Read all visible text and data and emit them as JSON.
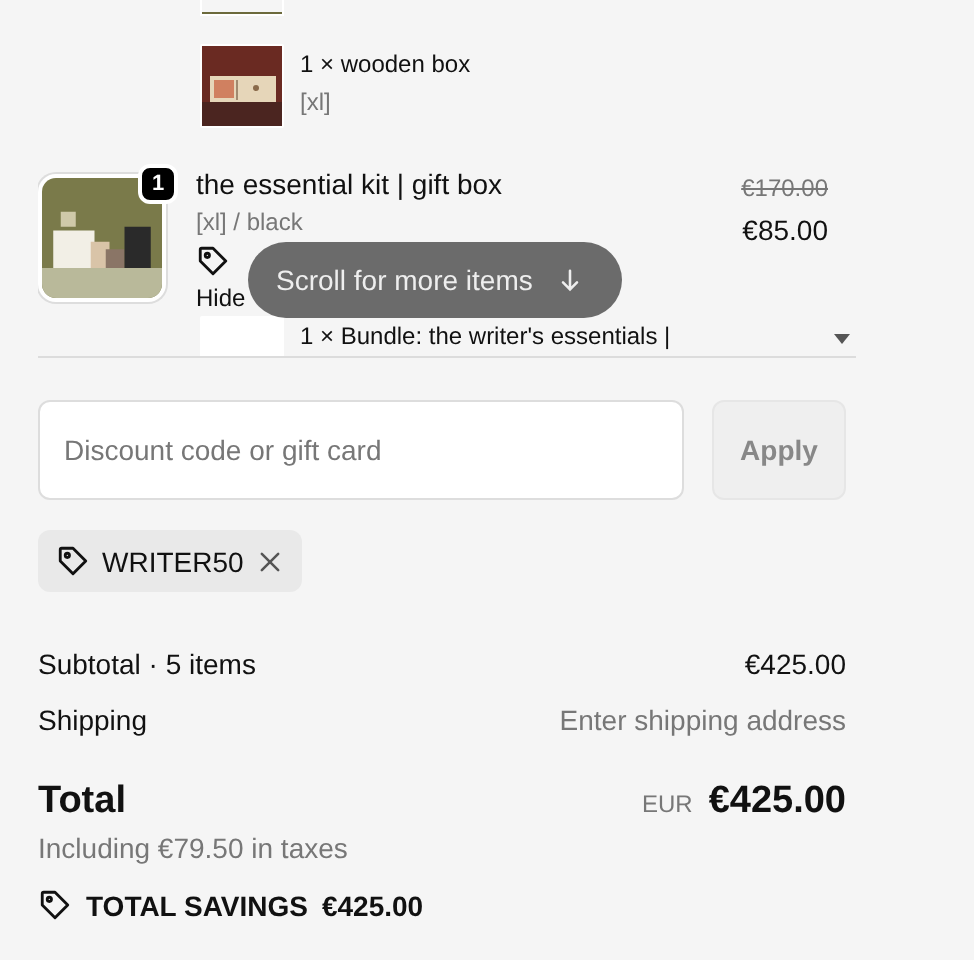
{
  "cart": {
    "items": [
      {
        "kind": "stub"
      },
      {
        "kind": "child",
        "title": "1 × wooden box",
        "variant": "[xl]"
      },
      {
        "kind": "main",
        "quantity": "1",
        "title": "the essential kit | gift box",
        "variant": "[xl] / black",
        "toggle": "Hide",
        "compare_price": "€170.00",
        "price": "€85.00"
      },
      {
        "kind": "child",
        "title": "1 × Bundle: the writer's essentials |"
      }
    ],
    "scroll_hint": "Scroll for more items"
  },
  "discount": {
    "placeholder": "Discount code or gift card",
    "button": "Apply",
    "applied": [
      {
        "code": "WRITER50"
      }
    ]
  },
  "summary": {
    "subtotal_label": "Subtotal · 5 items",
    "subtotal": "€425.00",
    "shipping_label": "Shipping",
    "shipping": "Enter shipping address",
    "total_label": "Total",
    "currency": "EUR",
    "total": "€425.00",
    "taxes": "Including €79.50 in taxes",
    "savings_label": "TOTAL SAVINGS",
    "savings": "€425.00"
  }
}
